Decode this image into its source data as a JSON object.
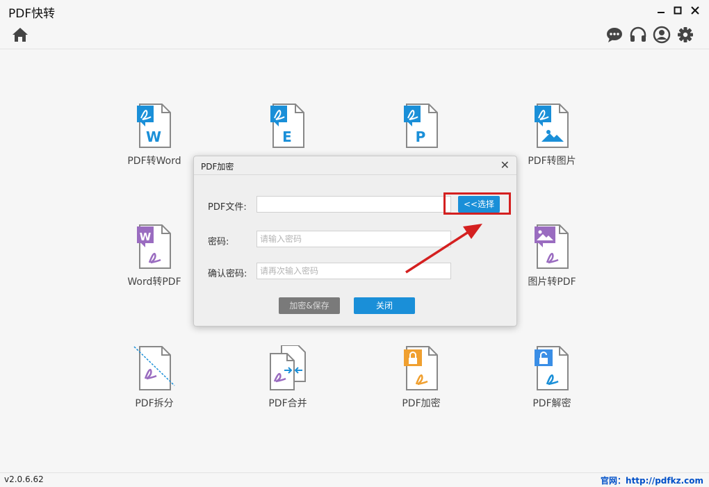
{
  "window": {
    "title": "PDF快转",
    "controls": [
      "minimize",
      "maximize",
      "close"
    ]
  },
  "toolbar": {
    "left_icons": [
      "home-icon"
    ],
    "right_icons": [
      "chat-icon",
      "headset-icon",
      "user-icon",
      "gear-icon"
    ]
  },
  "tiles": [
    {
      "label": "PDF转Word",
      "badge": "W"
    },
    {
      "label": "",
      "badge": "E"
    },
    {
      "label": "",
      "badge": "P"
    },
    {
      "label": "PDF转图片",
      "badge": "image"
    },
    {
      "label": "Word转PDF",
      "badge": "W"
    },
    {
      "label": "图片转PDF",
      "badge": "image"
    },
    {
      "label": "PDF拆分",
      "badge": "split"
    },
    {
      "label": "PDF合并",
      "badge": "merge"
    },
    {
      "label": "PDF加密",
      "badge": "lock"
    },
    {
      "label": "PDF解密",
      "badge": "unlock"
    }
  ],
  "dialog": {
    "title": "PDF加密",
    "close": "✕",
    "file_label": "PDF文件:",
    "file_value": "",
    "choose_button": "<<选择",
    "password_label": "密码:",
    "password_placeholder": "请输入密码",
    "confirm_label": "确认密码:",
    "confirm_placeholder": "请再次输入密码",
    "encrypt_button": "加密&保存",
    "close_button": "关闭"
  },
  "status": {
    "version": "v2.0.6.62",
    "site": "官网：http://pdfkz.com"
  },
  "colors": {
    "accent": "#1a8fd8",
    "purple": "#9a6cc0",
    "orange": "#f0a030",
    "disabled": "#7a7a7a",
    "annotation_red": "#d42020"
  }
}
